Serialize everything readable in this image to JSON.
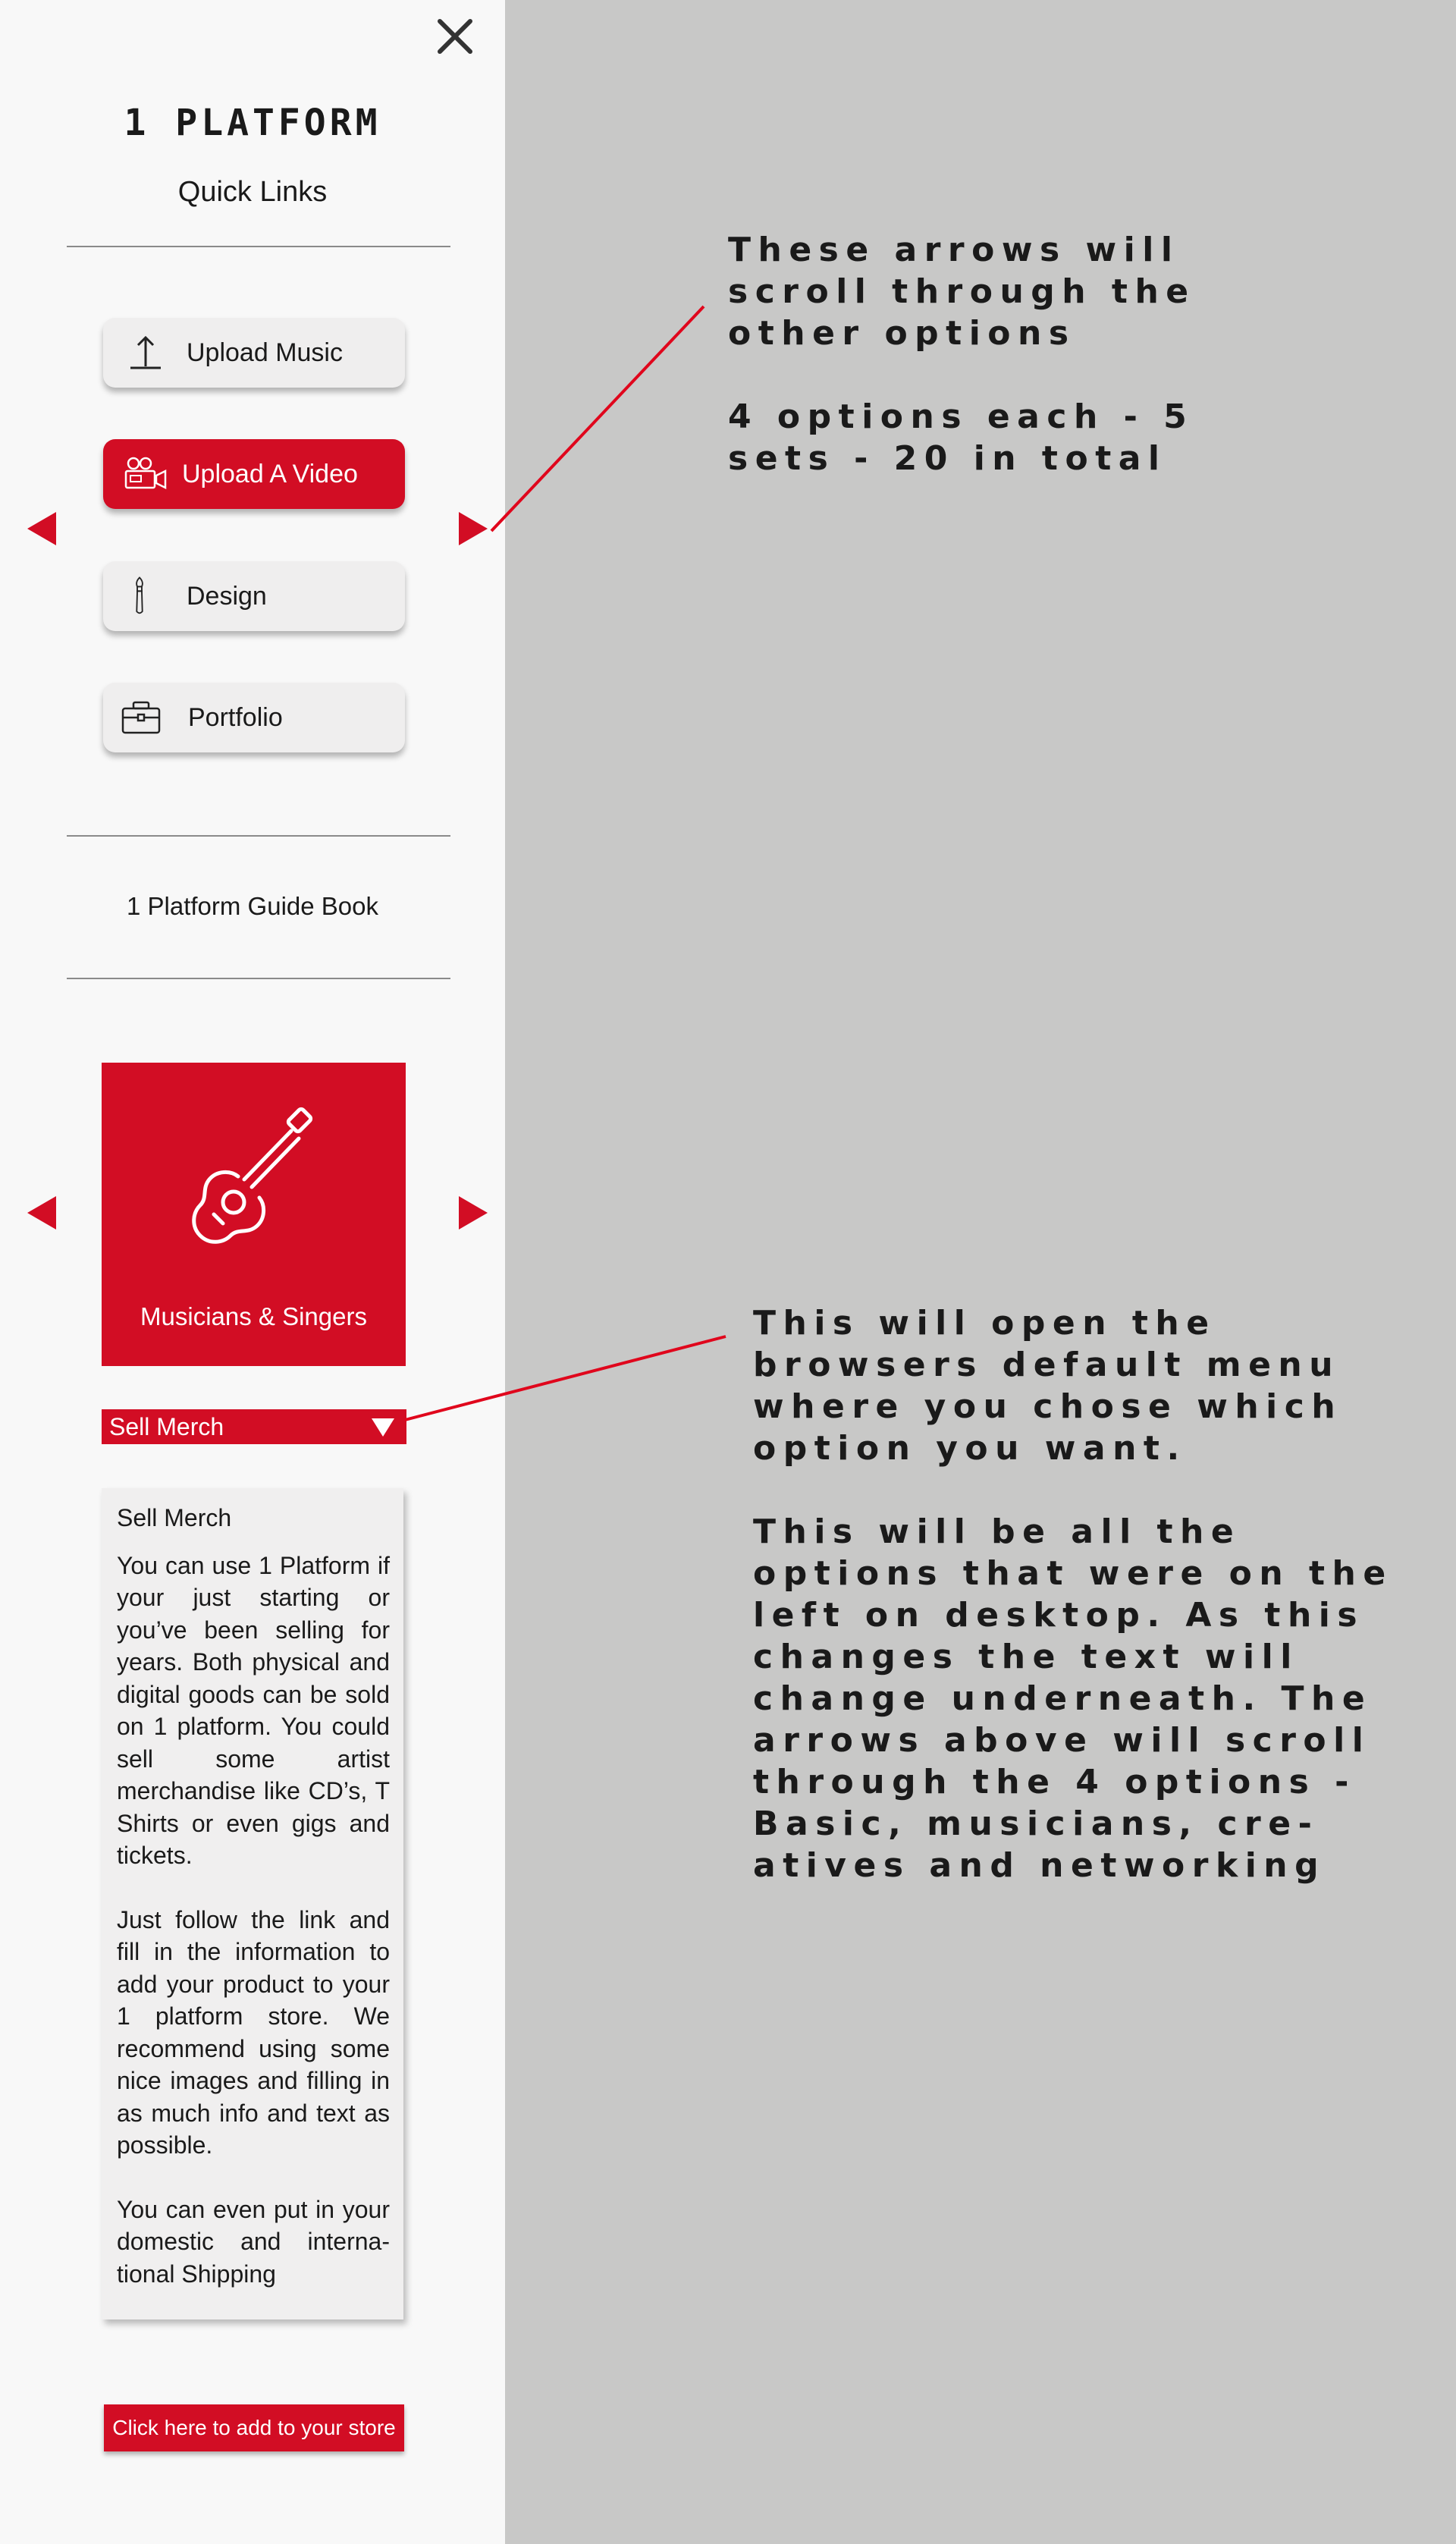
{
  "sidebar": {
    "logo_text": "1 PLATFORM",
    "subtitle": "Quick Links",
    "quick_links": [
      {
        "label": "Upload Music",
        "icon": "upload-icon",
        "active": false
      },
      {
        "label": "Upload A Video",
        "icon": "video-camera-icon",
        "active": true
      },
      {
        "label": "Design",
        "icon": "paintbrush-icon",
        "active": false
      },
      {
        "label": "Portfolio",
        "icon": "briefcase-icon",
        "active": false
      }
    ],
    "guide_link": "1 Platform Guide Book",
    "category": {
      "label": "Musicians & Singers",
      "icon": "guitar-icon"
    },
    "select": {
      "value": "Sell Merch"
    },
    "info": {
      "title": "Sell Merch",
      "paragraphs": [
        "You can use 1 Platform if your just starting or you’ve been selling for years. Both physical and digital goods can be sold on 1 platform. You could sell some artist merchandise like CD’s, T Shirts or even gigs and tickets.",
        "Just follow the link and fill in the information to add your product to your 1 platform store. We recommend using some nice images and filling in as much info and text as possible.",
        "You can even put in your domestic and interna-tional Shipping"
      ]
    },
    "cta_label": "Click here to add to your store"
  },
  "annotations": {
    "arrows_note": "These arrows will\nscroll through the\nother options\n\n4 options each - 5\nsets - 20 in total",
    "select_note": "This will open the\nbrowsers default menu\nwhere you chose which\noption you want.\n\nThis will be all the\noptions that were on the\nleft on desktop. As this\nchanges the text will\nchange underneath. The\narrows above will scroll\nthrough the 4 options -\nBasic, musicians, cre-\natives and networking"
  },
  "colors": {
    "accent": "#d20d24",
    "panel_bg": "#f8f8f8",
    "canvas_bg": "#c8c8c7",
    "text": "#1a1a1a"
  }
}
